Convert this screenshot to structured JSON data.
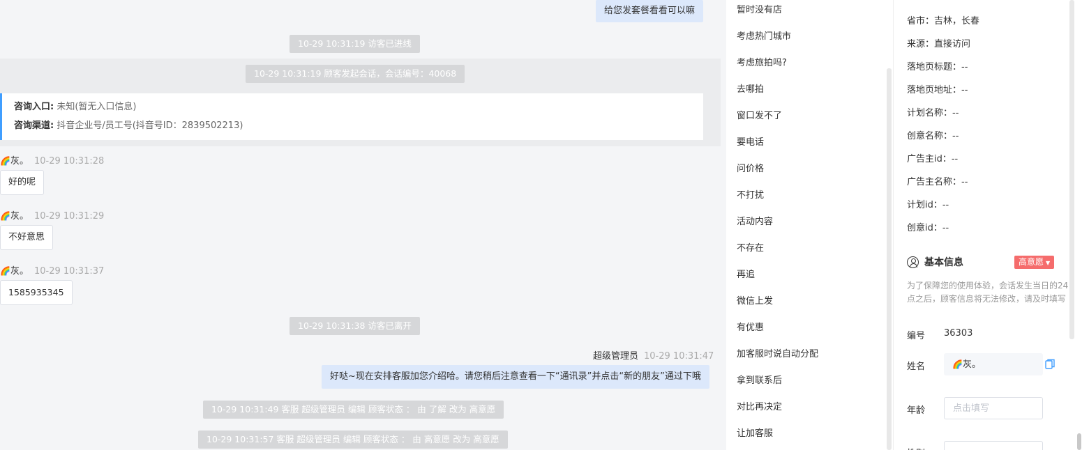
{
  "chat": {
    "top_outgoing": "给您发套餐看看可以嘛",
    "sys_visitor_in": "10-29 10:31:19 访客已进线",
    "sys_session_start": "10-29 10:31:19 顾客发起会话，会话编号：40068",
    "entry_label": "咨询入口:",
    "entry_value": "未知(暂无入口信息)",
    "channel_label": "咨询渠道:",
    "channel_value": "抖音企业号/员工号(抖音号ID：2839502213)",
    "messages": [
      {
        "sender": "灰。",
        "time": "10-29 10:31:28",
        "text": "好的呢"
      },
      {
        "sender": "灰。",
        "time": "10-29 10:31:29",
        "text": "不好意思"
      },
      {
        "sender": "灰。",
        "time": "10-29 10:31:37",
        "text": "1585935345"
      }
    ],
    "sys_visitor_left": "10-29 10:31:38 访客已离开",
    "agent_name": "超级管理员",
    "agent_time": "10-29 10:31:47",
    "agent_message": "好哒~现在安排客服加您介绍哈。请您稍后注意查看一下“通讯录”并点击“新的朋友”通过下哦",
    "sys_edit_1": "10-29 10:31:49 客服 超级管理员 编辑 顾客状态 ： 由 了解 改为 高意愿",
    "sys_edit_2": "10-29 10:31:57 客服 超级管理员 编辑 顾客状态 ： 由 高意愿 改为 高意愿"
  },
  "quick_replies": [
    "暂时没有店",
    "考虑热门城市",
    "考虑旅拍吗?",
    "去哪拍",
    "窗口发不了",
    "要电话",
    "问价格",
    "不打扰",
    "活动内容",
    "不存在",
    "再追",
    "微信上发",
    "有优惠",
    "加客服时说自动分配",
    "拿到联系后",
    "对比再决定",
    "让加客服"
  ],
  "info": {
    "lines": [
      "省市：吉林，长春",
      "来源：直接访问",
      "落地页标题：--",
      "落地页地址：--",
      "计划名称：--",
      "创意名称：--",
      "广告主id：--",
      "广告主名称：--",
      "计划id：--",
      "创意id：--"
    ],
    "section_title": "基本信息",
    "intent_badge": "高意愿",
    "hint": "为了保障您的使用体验，会话发生当日的24点之后，顾客信息将无法修改，请及时填写",
    "id_label": "编号",
    "id_value": "36303",
    "name_label": "姓名",
    "name_value": "灰。",
    "age_label": "年龄",
    "age_placeholder": "点击填写",
    "gender_label": "性别"
  },
  "colors": {
    "accent": "#409eff",
    "badge": "#f56c6c",
    "outgoing_bubble": "#dce8fb"
  },
  "icons": {
    "avatar": "rainbow-icon",
    "section": "user-circle-icon",
    "copy": "copy-icon",
    "badge_caret": "caret-down-icon"
  }
}
